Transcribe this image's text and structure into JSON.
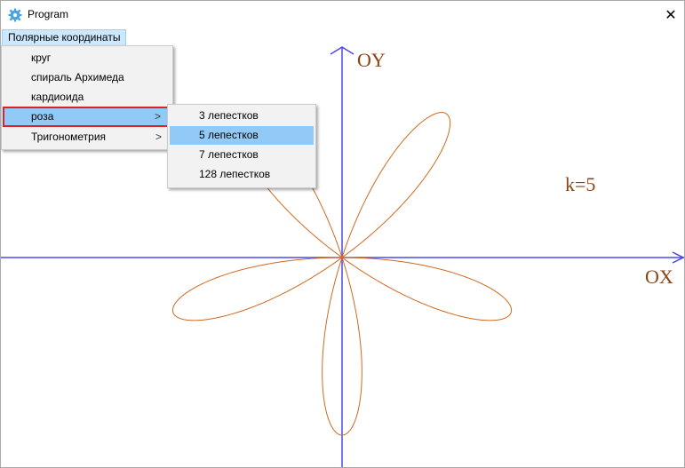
{
  "window": {
    "title": "Program",
    "close_glyph": "✕",
    "icon": "gear-icon"
  },
  "menubar": {
    "top_menu": "Полярные координаты"
  },
  "menu": {
    "items": [
      {
        "label": "круг"
      },
      {
        "label": "спираль Архимеда"
      },
      {
        "label": "кардиоида"
      },
      {
        "label": "роза",
        "submenu": true,
        "selected": true
      },
      {
        "label": "Тригонометрия",
        "submenu": true
      }
    ],
    "submenu_arrow": ">"
  },
  "submenu": {
    "items": [
      {
        "label": "3 лепестков"
      },
      {
        "label": "5 лепестков",
        "highlighted": true
      },
      {
        "label": "7 лепестков"
      },
      {
        "label": "128 лепестков"
      }
    ]
  },
  "plot": {
    "axis_x_label": "OX",
    "axis_y_label": "OY",
    "k_label": "k=5",
    "petals": 5,
    "axis_color": "#4a4ae8",
    "curve_color": "#d2691e",
    "label_color": "#8b4513"
  },
  "colors": {
    "menu_highlight": "#91c9f7",
    "selection_border": "#e02020"
  }
}
